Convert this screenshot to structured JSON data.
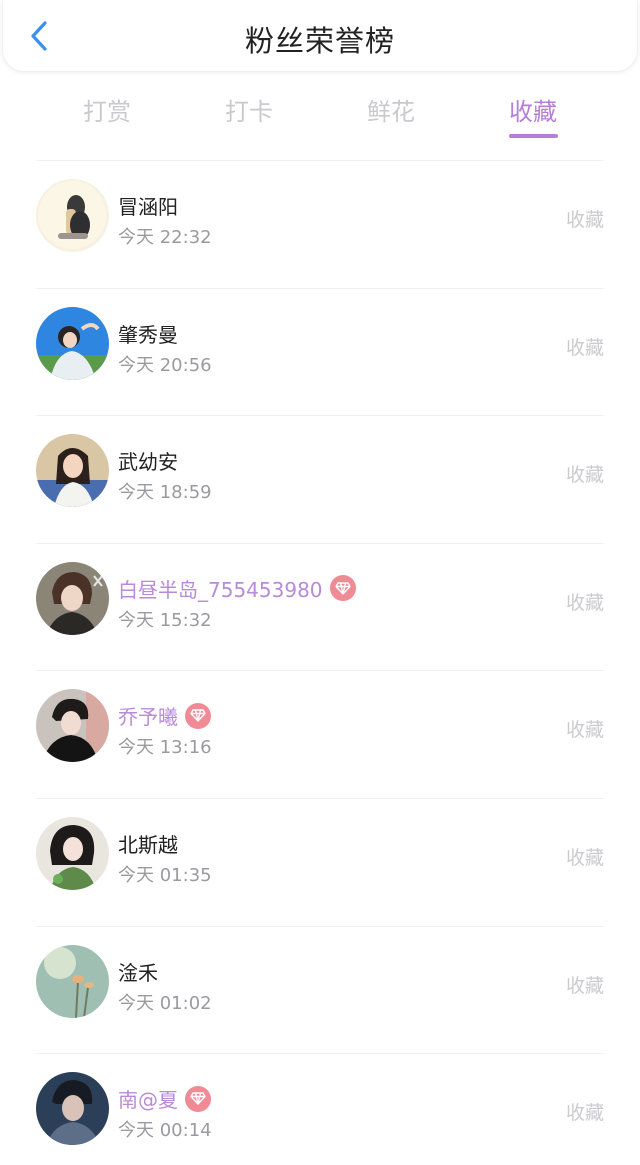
{
  "header": {
    "title": "粉丝荣誉榜",
    "back_icon": "chevron-left-icon",
    "accent_color": "#3a8ff0"
  },
  "tabs": [
    {
      "label": "打赏",
      "active": false
    },
    {
      "label": "打卡",
      "active": false
    },
    {
      "label": "鲜花",
      "active": false
    },
    {
      "label": "收藏",
      "active": true
    }
  ],
  "theme": {
    "active_tab_color": "#b47fd6",
    "vip_name_color": "#b98ad8",
    "vip_badge_color": "#f08a95"
  },
  "fans": [
    {
      "name": "冒涵阳",
      "time": "今天 22:32",
      "action": "收藏",
      "vip": false
    },
    {
      "name": "肇秀曼",
      "time": "今天 20:56",
      "action": "收藏",
      "vip": false
    },
    {
      "name": "武幼安",
      "time": "今天 18:59",
      "action": "收藏",
      "vip": false
    },
    {
      "name": "白昼半岛_755453980",
      "time": "今天 15:32",
      "action": "收藏",
      "vip": true
    },
    {
      "name": "乔予曦",
      "time": "今天 13:16",
      "action": "收藏",
      "vip": true
    },
    {
      "name": "北斯越",
      "time": "今天 01:35",
      "action": "收藏",
      "vip": false
    },
    {
      "name": "淦禾",
      "time": "今天 01:02",
      "action": "收藏",
      "vip": false
    },
    {
      "name": "南@夏",
      "time": "今天 00:14",
      "action": "收藏",
      "vip": true
    }
  ]
}
